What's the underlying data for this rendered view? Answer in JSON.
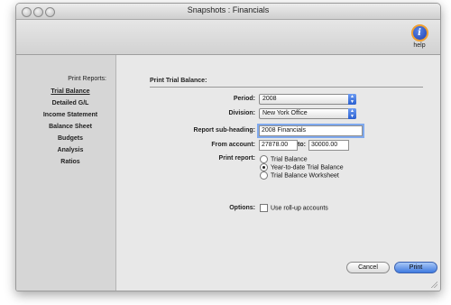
{
  "window": {
    "title": "Snapshots : Financials"
  },
  "toolbar": {
    "help_label": "help",
    "help_glyph": "i"
  },
  "sidebar": {
    "heading": "Print Reports:",
    "items": [
      {
        "label": "Trial Balance",
        "active": true
      },
      {
        "label": "Detailed G/L",
        "active": false
      },
      {
        "label": "Income Statement",
        "active": false
      },
      {
        "label": "Balance Sheet",
        "active": false
      },
      {
        "label": "Budgets",
        "active": false
      },
      {
        "label": "Analysis",
        "active": false
      },
      {
        "label": "Ratios",
        "active": false
      }
    ]
  },
  "form": {
    "section_title": "Print Trial Balance:",
    "period_label": "Period:",
    "period_value": "2008",
    "division_label": "Division:",
    "division_value": "New York Office",
    "subheading_label": "Report sub-heading:",
    "subheading_value": "2008 Financials",
    "from_account_label": "From account:",
    "from_account_value": "27878.00",
    "to_label": "to:",
    "to_account_value": "30000.00",
    "print_report_label": "Print report:",
    "report_options": [
      {
        "label": "Trial Balance",
        "selected": false
      },
      {
        "label": "Year-to-date Trial Balance",
        "selected": true
      },
      {
        "label": "Trial Balance Worksheet",
        "selected": false
      }
    ],
    "options_label": "Options:",
    "rollup_label": "Use roll-up accounts",
    "rollup_checked": false
  },
  "buttons": {
    "cancel": "Cancel",
    "print": "Print"
  },
  "colors": {
    "accent": "#3f7ae0",
    "sidebar_bg": "#d6d6d6",
    "window_bg": "#e8e8e8"
  }
}
